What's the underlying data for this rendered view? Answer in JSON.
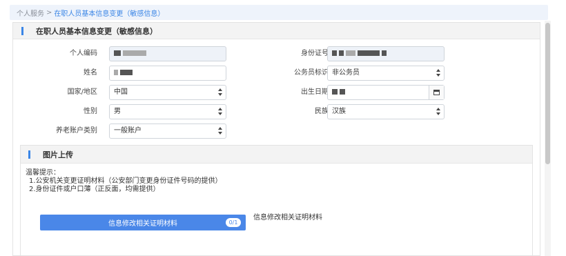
{
  "breadcrumb": {
    "home": "个人服务",
    "separator": ">",
    "current": "在职人员基本信息变更（敏感信息）"
  },
  "panel": {
    "title": "在职人员基本信息变更（敏感信息）"
  },
  "form": {
    "personal_code_label": "个人编码",
    "id_number_label": "身份证号",
    "name_label": "姓名",
    "civil_servant_label": "公务员标识",
    "civil_servant_value": "非公务员",
    "country_label": "国家/地区",
    "country_value": "中国",
    "birth_date_label": "出生日期",
    "gender_label": "性别",
    "gender_value": "男",
    "ethnicity_label": "民族",
    "ethnicity_value": "汉族",
    "pension_type_label": "养老账户类别",
    "pension_type_value": "一般账户"
  },
  "upload": {
    "title": "图片上传",
    "tips_title": "温馨提示：",
    "tips": [
      "1.公安机关变更证明材料（公安部门变更身份证件号码的提供）",
      "2.身份证件或户口薄（正反面，均需提供）"
    ],
    "button_label": "信息修改相关证明材料",
    "count": "0/1",
    "description": "信息修改相关证明材料"
  },
  "icons": {
    "select": "select-arrows-icon",
    "calendar": "calendar-icon"
  },
  "colors": {
    "accent": "#3b86e6",
    "button": "#4a87e8",
    "breadcrumb_bg": "#eef3fb"
  }
}
